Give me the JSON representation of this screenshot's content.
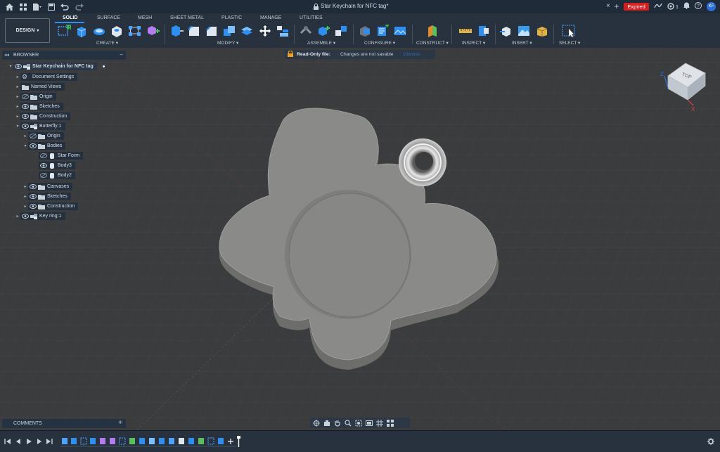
{
  "window": {
    "title": "Star Keychain for NFC tag*"
  },
  "titlebar": {
    "expired_label": "Expired",
    "count": "1",
    "avatar_initials": "KF"
  },
  "workspace": {
    "label": "DESIGN"
  },
  "tabs": [
    {
      "label": "SOLID",
      "active": true
    },
    {
      "label": "SURFACE"
    },
    {
      "label": "MESH"
    },
    {
      "label": "SHEET METAL"
    },
    {
      "label": "PLASTIC"
    },
    {
      "label": "MANAGE"
    },
    {
      "label": "UTILITIES"
    }
  ],
  "groups": [
    {
      "label": "CREATE"
    },
    {
      "label": "MODIFY"
    },
    {
      "label": "ASSEMBLE"
    },
    {
      "label": "CONFIGURE"
    },
    {
      "label": "CONSTRUCT"
    },
    {
      "label": "INSPECT"
    },
    {
      "label": "INSERT"
    },
    {
      "label": "SELECT"
    }
  ],
  "browser": {
    "title": "BROWSER",
    "items": [
      {
        "label": "Star Keychain for NFC tag"
      },
      {
        "label": "Document Settings"
      },
      {
        "label": "Named Views"
      },
      {
        "label": "Origin"
      },
      {
        "label": "Sketches"
      },
      {
        "label": "Construction"
      },
      {
        "label": "Butterfly:1"
      },
      {
        "label": "Origin"
      },
      {
        "label": "Bodies"
      },
      {
        "label": "Star Form"
      },
      {
        "label": "Body3"
      },
      {
        "label": "Body2"
      },
      {
        "label": "Canvases"
      },
      {
        "label": "Sketches"
      },
      {
        "label": "Construction"
      },
      {
        "label": "Key ring:1"
      }
    ]
  },
  "banner": {
    "title": "Read-Only file:",
    "message": "Changes are not savable",
    "action": "Dismiss"
  },
  "viewcube": {
    "face_label": "TOP",
    "axis_z": "Z",
    "axis_x": "X"
  },
  "comments": {
    "title": "COMMENTS"
  },
  "colors": {
    "accent": "#2e8ff0",
    "expired": "#d41f1f",
    "ribbon": "#27323e",
    "titlebar": "#1f2b38"
  }
}
